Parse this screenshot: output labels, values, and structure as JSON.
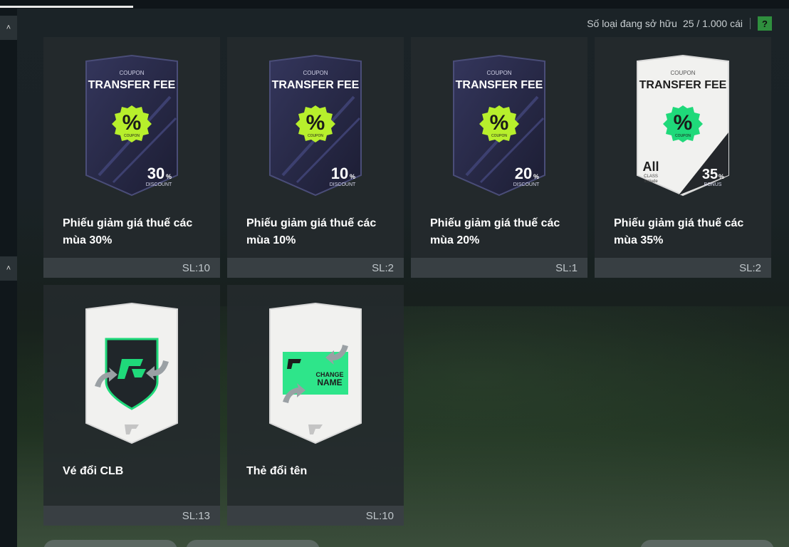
{
  "header": {
    "owned_label": "Số loại đang sở hữu",
    "owned_value": "25 / 1.000 cái",
    "help_label": "?"
  },
  "rail": {
    "up_arrow": "˄"
  },
  "items": [
    {
      "name": "Phiếu giảm giá thuế các mùa 30%",
      "qty": "SL:10",
      "art": {
        "top": "COUPON",
        "title": "TRANSFER FEE",
        "badge": "%",
        "badge_sub": "COUPON",
        "value": "30",
        "unit": "%",
        "sub": "DISCOUNT"
      }
    },
    {
      "name": "Phiếu giảm giá thuế các mùa 10%",
      "qty": "SL:2",
      "art": {
        "top": "COUPON",
        "title": "TRANSFER FEE",
        "badge": "%",
        "badge_sub": "COUPON",
        "value": "10",
        "unit": "%",
        "sub": "DISCOUNT"
      }
    },
    {
      "name": "Phiếu giảm giá thuế các mùa 20%",
      "qty": "SL:1",
      "art": {
        "top": "COUPON",
        "title": "TRANSFER FEE",
        "badge": "%",
        "badge_sub": "COUPON",
        "value": "20",
        "unit": "%",
        "sub": "DISCOUNT"
      }
    },
    {
      "name": "Phiếu giảm giá thuế các mùa 35%",
      "qty": "SL:2",
      "art": {
        "top": "COUPON",
        "title": "TRANSFER FEE",
        "badge": "%",
        "badge_sub": "COUPON",
        "value": "35",
        "unit": "%",
        "sub": "BONUS",
        "all": "All",
        "all_sub1": "CLASS",
        "all_sub2": "Include"
      }
    },
    {
      "name": "Vé đổi CLB",
      "qty": "SL:13"
    },
    {
      "name": "Thẻ đổi tên",
      "qty": "SL:10",
      "art": {
        "change1": "CHANGE",
        "change2": "NAME"
      }
    }
  ],
  "colors": {
    "coupon_dark": "#2a2b4a",
    "badge_green": "#b7ef2c",
    "badge_green2": "#1fd97a",
    "white_card": "#f1f1ef"
  }
}
